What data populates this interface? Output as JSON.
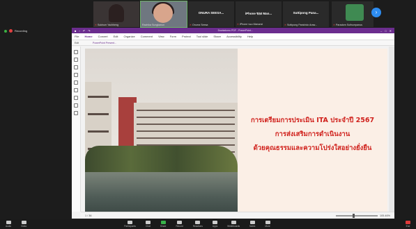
{
  "participants": [
    {
      "name": "Sukhum Yachheng",
      "has_video": true
    },
    {
      "name": "Rachika Sungkanun",
      "has_video": true,
      "active_speaker": true
    },
    {
      "name": "ONURA SEESA...",
      "caption": "Onurra Seesa",
      "has_video": false
    },
    {
      "name": "iPhone ของ Man...",
      "caption": "iPhone ของ Manurat",
      "has_video": false
    },
    {
      "name": "Suttipong Pana...",
      "caption": "Suttipong Panichdo Araw...",
      "has_video": false
    },
    {
      "name": "",
      "caption": "Paradorn Suthumpanus",
      "has_video": false,
      "logo": true
    }
  ],
  "next_page_icon": "arrow-right-icon",
  "recording": {
    "label": "Recording"
  },
  "viewer": {
    "title": "Dowiadomu PDF - PowerPoint...",
    "menu": [
      "File",
      "Home",
      "Convert",
      "Edit",
      "Organize",
      "Comment",
      "View",
      "Form",
      "Protect",
      "Tool slide",
      "Share",
      "Accessibility",
      "Help"
    ],
    "active_menu": "Home",
    "tab_label": "Edit",
    "doc_tab": "PowerPoint Present...",
    "page_indicator": "1 / 36",
    "zoom": "105.46%"
  },
  "slide": {
    "lines": [
      "การเตรียมการประเมิน ITA ประจำปี 2567",
      "การส่งเสริมการดำเนินงาน",
      "ด้วยคุณธรรมและความโปร่งใสอย่างยั่งยืน"
    ],
    "accent_color": "#d0211c"
  },
  "toolbar": {
    "left": [
      {
        "label": "Audio",
        "icon": "microphone-icon"
      },
      {
        "label": "Video",
        "icon": "video-icon"
      }
    ],
    "center": [
      {
        "label": "Participants",
        "icon": "participants-icon"
      },
      {
        "label": "Chat",
        "icon": "chat-icon"
      },
      {
        "label": "Share",
        "icon": "share-icon",
        "highlight": "green"
      },
      {
        "label": "Record",
        "icon": "record-icon"
      },
      {
        "label": "Reactions",
        "icon": "reactions-icon"
      },
      {
        "label": "Apps",
        "icon": "apps-icon"
      },
      {
        "label": "Whiteboards",
        "icon": "whiteboard-icon"
      },
      {
        "label": "Notes",
        "icon": "notes-icon"
      },
      {
        "label": "More",
        "icon": "more-icon"
      }
    ],
    "end": {
      "label": "End",
      "icon": "end-icon"
    }
  }
}
